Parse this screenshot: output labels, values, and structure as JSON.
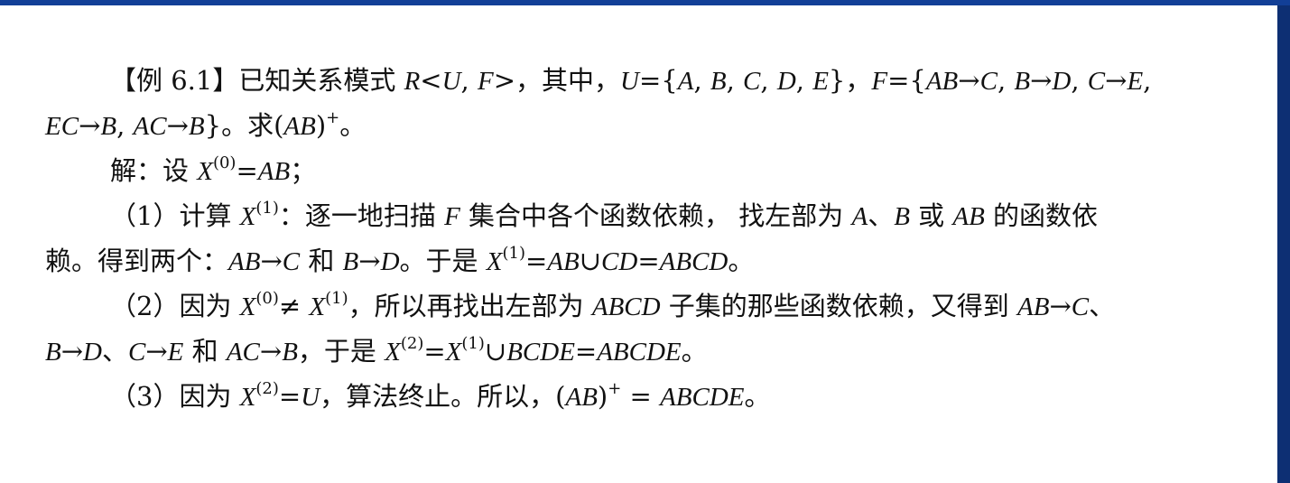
{
  "lines": [
    {
      "indent": true,
      "segments": [
        {
          "t": "【例 6.1】已知关系模式 "
        },
        {
          "t": "R",
          "i": true
        },
        {
          "t": "<"
        },
        {
          "t": "U",
          "i": true
        },
        {
          "t": ", "
        },
        {
          "t": "F",
          "i": true
        },
        {
          "t": ">，其中，"
        },
        {
          "t": "U",
          "i": true
        },
        {
          "t": "={"
        },
        {
          "t": "A",
          "i": true
        },
        {
          "t": ", "
        },
        {
          "t": "B",
          "i": true
        },
        {
          "t": ", "
        },
        {
          "t": "C",
          "i": true
        },
        {
          "t": ", "
        },
        {
          "t": "D",
          "i": true
        },
        {
          "t": ", "
        },
        {
          "t": "E",
          "i": true
        },
        {
          "t": "}，"
        },
        {
          "t": "F",
          "i": true
        },
        {
          "t": "={"
        },
        {
          "t": "AB",
          "i": true
        },
        {
          "t": "→"
        },
        {
          "t": "C",
          "i": true
        },
        {
          "t": ", "
        },
        {
          "t": "B",
          "i": true
        },
        {
          "t": "→"
        },
        {
          "t": "D",
          "i": true
        },
        {
          "t": ", "
        },
        {
          "t": "C",
          "i": true
        },
        {
          "t": "→"
        },
        {
          "t": "E",
          "i": true
        },
        {
          "t": ","
        }
      ]
    },
    {
      "indent": false,
      "segments": [
        {
          "t": "EC",
          "i": true
        },
        {
          "t": "→"
        },
        {
          "t": "B",
          "i": true
        },
        {
          "t": ", "
        },
        {
          "t": "AC",
          "i": true
        },
        {
          "t": "→"
        },
        {
          "t": "B",
          "i": true
        },
        {
          "t": "}。求("
        },
        {
          "t": "AB",
          "i": true
        },
        {
          "t": ")"
        },
        {
          "t": "+",
          "sup": true
        },
        {
          "t": "。"
        }
      ]
    },
    {
      "indent": true,
      "segments": [
        {
          "t": "解：设 "
        },
        {
          "t": "X",
          "i": true
        },
        {
          "t": "(0)",
          "sup": true
        },
        {
          "t": "="
        },
        {
          "t": "AB",
          "i": true
        },
        {
          "t": "；"
        }
      ]
    },
    {
      "indent": true,
      "segments": [
        {
          "t": "（1）计算 "
        },
        {
          "t": "X",
          "i": true
        },
        {
          "t": "(1)",
          "sup": true
        },
        {
          "t": "：逐一地扫描 "
        },
        {
          "t": "F",
          "i": true
        },
        {
          "t": " 集合中各个函数依赖，  找左部为 "
        },
        {
          "t": "A",
          "i": true
        },
        {
          "t": "、"
        },
        {
          "t": "B",
          "i": true
        },
        {
          "t": " 或 "
        },
        {
          "t": "AB",
          "i": true
        },
        {
          "t": " 的函数依"
        }
      ]
    },
    {
      "indent": false,
      "segments": [
        {
          "t": "赖。得到两个："
        },
        {
          "t": "AB",
          "i": true
        },
        {
          "t": "→"
        },
        {
          "t": "C",
          "i": true
        },
        {
          "t": " 和 "
        },
        {
          "t": "B",
          "i": true
        },
        {
          "t": "→"
        },
        {
          "t": "D",
          "i": true
        },
        {
          "t": "。于是 "
        },
        {
          "t": "X",
          "i": true
        },
        {
          "t": "(1)",
          "sup": true
        },
        {
          "t": "="
        },
        {
          "t": "AB",
          "i": true
        },
        {
          "t": "∪"
        },
        {
          "t": "CD",
          "i": true
        },
        {
          "t": "="
        },
        {
          "t": "ABCD",
          "i": true
        },
        {
          "t": "。"
        }
      ]
    },
    {
      "indent": true,
      "segments": [
        {
          "t": "（2）因为 "
        },
        {
          "t": "X",
          "i": true
        },
        {
          "t": "(0)",
          "sup": true
        },
        {
          "t": "≠ "
        },
        {
          "t": "X",
          "i": true
        },
        {
          "t": "(1)",
          "sup": true
        },
        {
          "t": "，所以再找出左部为 "
        },
        {
          "t": "ABCD",
          "i": true
        },
        {
          "t": " 子集的那些函数依赖，又得到 "
        },
        {
          "t": "AB",
          "i": true
        },
        {
          "t": "→"
        },
        {
          "t": "C",
          "i": true
        },
        {
          "t": "、"
        }
      ]
    },
    {
      "indent": false,
      "segments": [
        {
          "t": "B",
          "i": true
        },
        {
          "t": "→"
        },
        {
          "t": "D",
          "i": true
        },
        {
          "t": "、"
        },
        {
          "t": "C",
          "i": true
        },
        {
          "t": "→"
        },
        {
          "t": "E",
          "i": true
        },
        {
          "t": " 和 "
        },
        {
          "t": "AC",
          "i": true
        },
        {
          "t": "→"
        },
        {
          "t": "B",
          "i": true
        },
        {
          "t": "，于是 "
        },
        {
          "t": "X",
          "i": true
        },
        {
          "t": "(2)",
          "sup": true
        },
        {
          "t": "="
        },
        {
          "t": "X",
          "i": true
        },
        {
          "t": "(1)",
          "sup": true
        },
        {
          "t": "∪"
        },
        {
          "t": "BCDE",
          "i": true
        },
        {
          "t": "="
        },
        {
          "t": "ABCDE",
          "i": true
        },
        {
          "t": "。"
        }
      ]
    },
    {
      "indent": true,
      "segments": [
        {
          "t": "（3）因为 "
        },
        {
          "t": "X",
          "i": true
        },
        {
          "t": "(2)",
          "sup": true
        },
        {
          "t": "="
        },
        {
          "t": "U",
          "i": true
        },
        {
          "t": "，算法终止。所以，("
        },
        {
          "t": "AB",
          "i": true
        },
        {
          "t": ")"
        },
        {
          "t": "+",
          "sup": true
        },
        {
          "t": " = "
        },
        {
          "t": "ABCDE",
          "i": true
        },
        {
          "t": "。"
        }
      ]
    }
  ]
}
